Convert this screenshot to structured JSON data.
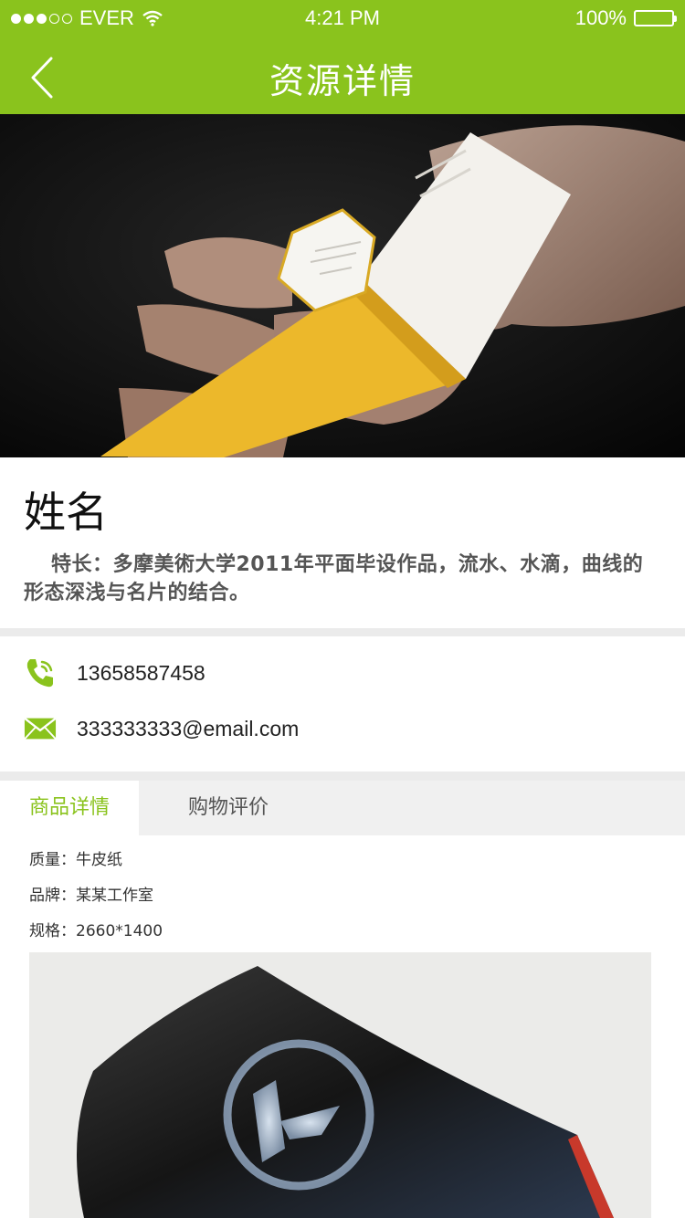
{
  "status_bar": {
    "carrier": "EVER",
    "time": "4:21 PM",
    "battery": "100%"
  },
  "nav": {
    "title": "资源详情",
    "back_icon": "chevron-left-icon"
  },
  "profile": {
    "name": "姓名",
    "description": "特长：多摩美術大学2011年平面毕设作品，流水、水滴，曲线的形态深浅与名片的结合。"
  },
  "contact": {
    "phone": "13658587458",
    "email": "333333333@email.com",
    "phone_icon": "phone-icon",
    "email_icon": "mail-icon",
    "icon_color": "#8ac31d"
  },
  "tabs": [
    {
      "label": "商品详情",
      "active": true
    },
    {
      "label": "购物评价",
      "active": false
    }
  ],
  "specs": [
    {
      "text": "质量：牛皮纸"
    },
    {
      "text": "品牌：某某工作室"
    },
    {
      "text": "规格：2660*1400"
    }
  ],
  "colors": {
    "accent": "#8ac31d",
    "divider": "#ebebeb"
  }
}
